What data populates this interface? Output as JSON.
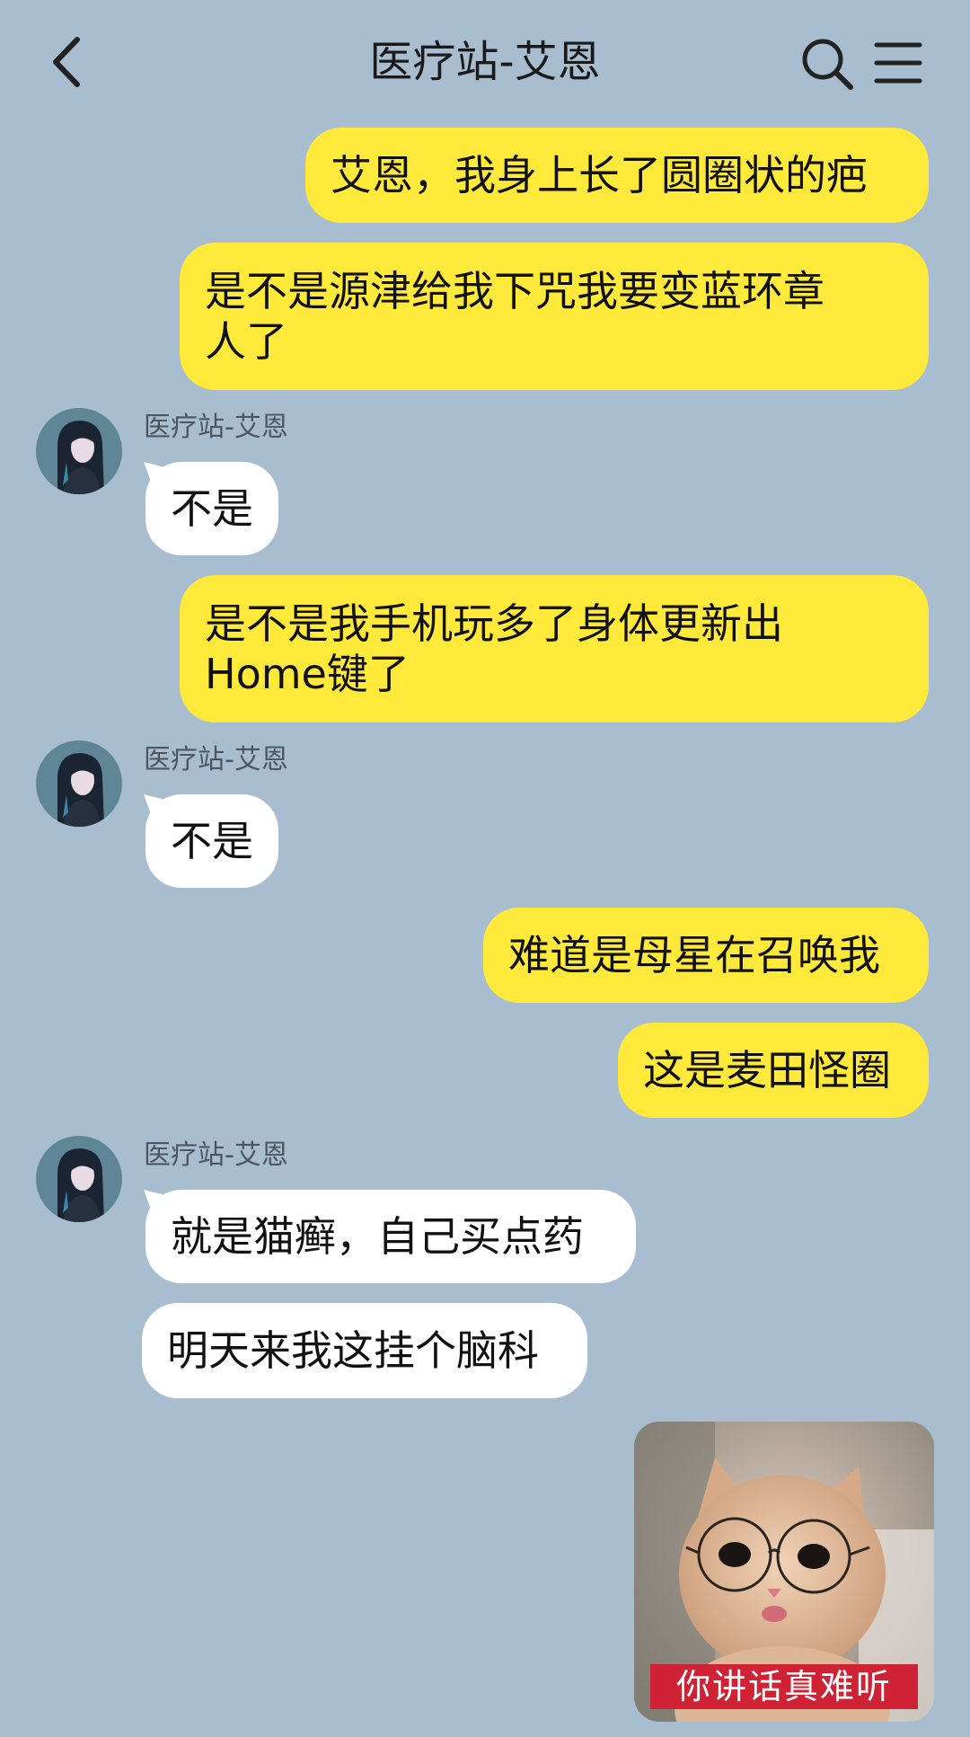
{
  "header": {
    "title": "医疗站-艾恩",
    "back_icon": "chevron-left-icon",
    "search_icon": "search-icon",
    "menu_icon": "menu-icon"
  },
  "messages": [
    {
      "from": "me",
      "text": "艾恩，我身上长了圆圈状的疤"
    },
    {
      "from": "me",
      "text_lines": [
        "是不是源津给我下咒我要变蓝环章",
        "人了"
      ]
    },
    {
      "from": "other",
      "sender": "医疗站-艾恩",
      "text": "不是"
    },
    {
      "from": "me",
      "text_lines": [
        "是不是我手机玩多了身体更新出",
        "Home键了"
      ]
    },
    {
      "from": "other",
      "sender": "医疗站-艾恩",
      "text": "不是"
    },
    {
      "from": "me",
      "text": "难道是母星在召唤我"
    },
    {
      "from": "me",
      "text": "这是麦田怪圈"
    },
    {
      "from": "other",
      "sender": "医疗站-艾恩",
      "text": "就是猫癣，自己买点药"
    },
    {
      "from": "other",
      "text": "明天来我这挂个脑科"
    },
    {
      "from": "me",
      "type": "sticker",
      "caption": "你讲话真难听"
    }
  ],
  "colors": {
    "background": "#a9bdd0",
    "my_bubble": "#ffe93a",
    "other_bubble": "#ffffff",
    "sticker_caption_bg": "#cf2335"
  }
}
